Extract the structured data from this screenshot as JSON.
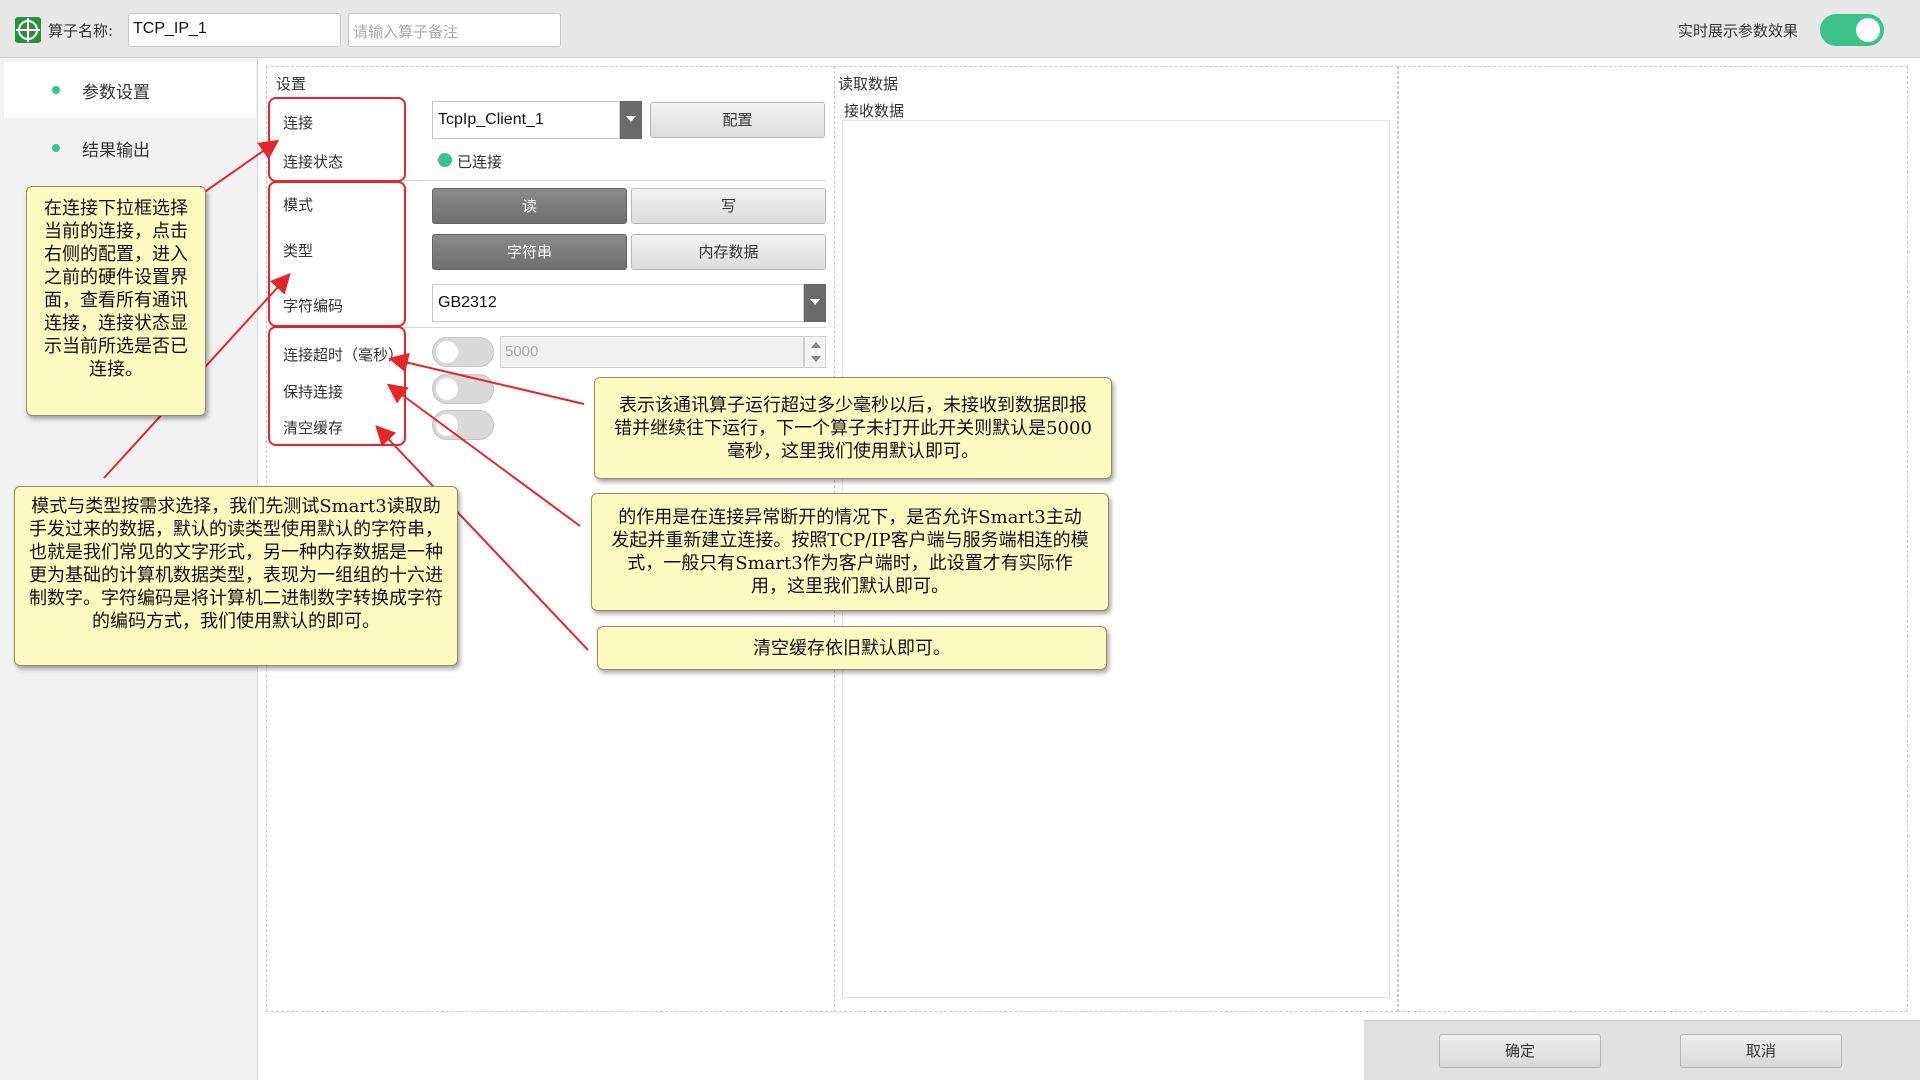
{
  "header": {
    "name_label": "算子名称:",
    "name_value": "TCP_IP_1",
    "note_placeholder": "请输入算子备注",
    "realtime_label": "实时展示参数效果",
    "realtime_on": true
  },
  "sidebar": {
    "items": [
      {
        "label": "参数设置",
        "active": true
      },
      {
        "label": "结果输出",
        "active": false
      }
    ]
  },
  "settings": {
    "title": "设置",
    "connection_label": "连接",
    "connection_value": "TcpIp_Client_1",
    "config_button": "配置",
    "status_label": "连接状态",
    "status_value": "已连接",
    "mode_label": "模式",
    "mode_read": "读",
    "mode_write": "写",
    "mode_selected": "读",
    "type_label": "类型",
    "type_string": "字符串",
    "type_memory": "内存数据",
    "type_selected": "字符串",
    "encoding_label": "字符编码",
    "encoding_value": "GB2312",
    "timeout_label": "连接超时（毫秒）",
    "timeout_value": "5000",
    "timeout_enabled": false,
    "keepalive_label": "保持连接",
    "keepalive_enabled": false,
    "clear_cache_label": "清空缓存",
    "clear_cache_enabled": false
  },
  "read_data": {
    "title": "读取数据",
    "receive_label": "接收数据"
  },
  "footer": {
    "confirm": "确定",
    "cancel": "取消"
  },
  "annotations": {
    "connection_note": "在连接下拉框选择当前的连接，点击右侧的配置，进入之前的硬件设置界面，查看所有通讯连接，连接状态显示当前所选是否已连接。",
    "mode_type_note": "模式与类型按需求选择，我们先测试Smart3读取助手发过来的数据，默认的读类型使用默认的字符串，也就是我们常见的文字形式，另一种内存数据是一种更为基础的计算机数据类型，表现为一组组的十六进制数字。字符编码是将计算机二进制数字转换成字符的编码方式，我们使用默认的即可。",
    "timeout_note": "表示该通讯算子运行超过多少毫秒以后，未接收到数据即报错并继续往下运行，下一个算子未打开此开关则默认是5000毫秒，这里我们使用默认即可。",
    "keepalive_note": "的作用是在连接异常断开的情况下，是否允许Smart3主动发起并重新建立连接。按照TCP/IP客户端与服务端相连的模式，一般只有Smart3作为客户端时，此设置才有实际作用，这里我们默认即可。",
    "clear_cache_note": "清空缓存依旧默认即可。"
  },
  "colors": {
    "accent_green": "#3cc28a",
    "annotation_red": "#e3262b",
    "callout_bg": "#fdfbc2"
  }
}
